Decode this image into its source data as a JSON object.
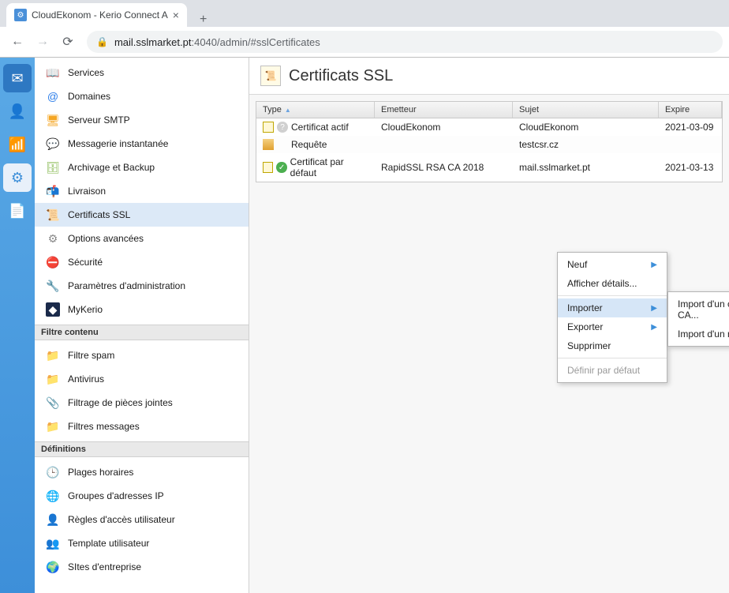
{
  "browser": {
    "tab_title": "CloudEkonom - Kerio Connect A",
    "url_host": "mail.sslmarket.pt",
    "url_rest": ":4040/admin/#sslCertificates"
  },
  "sidebar": {
    "config": [
      {
        "label": "Services"
      },
      {
        "label": "Domaines"
      },
      {
        "label": "Serveur SMTP"
      },
      {
        "label": "Messagerie instantanée"
      },
      {
        "label": "Archivage et Backup"
      },
      {
        "label": "Livraison"
      },
      {
        "label": "Certificats SSL"
      },
      {
        "label": "Options avancées"
      },
      {
        "label": "Sécurité"
      },
      {
        "label": "Paramètres d'administration"
      },
      {
        "label": "MyKerio"
      }
    ],
    "filter_header": "Filtre contenu",
    "filter": [
      {
        "label": "Filtre spam"
      },
      {
        "label": "Antivirus"
      },
      {
        "label": "Filtrage de pièces jointes"
      },
      {
        "label": "Filtres messages"
      }
    ],
    "def_header": "Définitions",
    "defs": [
      {
        "label": "Plages horaires"
      },
      {
        "label": "Groupes d'adresses IP"
      },
      {
        "label": "Règles d'accès utilisateur"
      },
      {
        "label": "Template utilisateur"
      },
      {
        "label": "SItes d'entreprise"
      }
    ]
  },
  "page": {
    "title": "Certificats SSL",
    "columns": {
      "type": "Type",
      "emetteur": "Emetteur",
      "sujet": "Sujet",
      "expire": "Expire"
    },
    "rows": [
      {
        "type": "Certificat actif",
        "emetteur": "CloudEkonom",
        "sujet": "CloudEkonom",
        "expire": "2021-03-09",
        "status": "q"
      },
      {
        "type": "Requête",
        "emetteur": "",
        "sujet": "testcsr.cz",
        "expire": "",
        "status": "req"
      },
      {
        "type": "Certificat par défaut",
        "emetteur": "RapidSSL RSA CA 2018",
        "sujet": "mail.sslmarket.pt",
        "expire": "2021-03-13",
        "status": "ok"
      }
    ]
  },
  "menu": {
    "neuf": "Neuf",
    "details": "Afficher détails...",
    "importer": "Importer",
    "exporter": "Exporter",
    "supprimer": "Supprimer",
    "defaut": "Définir par défaut",
    "sub_ca": "Import d'un certificat signé de CA...",
    "sub_new": "Import d'un nouveau certificat..."
  }
}
